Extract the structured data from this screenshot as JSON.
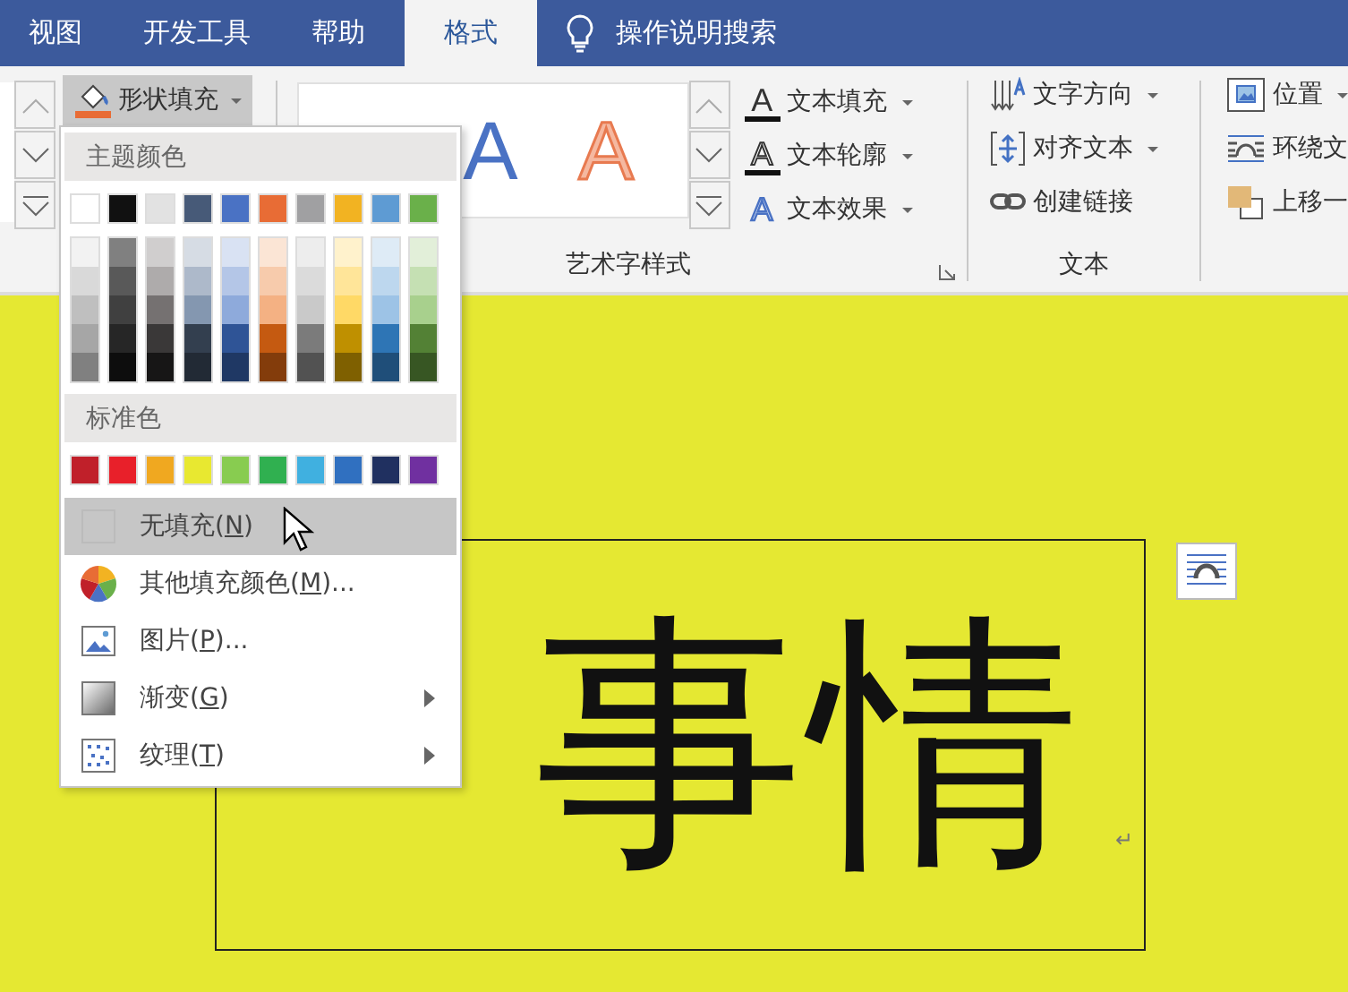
{
  "tabs": [
    {
      "label": "视图",
      "selected": false
    },
    {
      "label": "开发工具",
      "selected": false
    },
    {
      "label": "帮助",
      "selected": false
    },
    {
      "label": "格式",
      "selected": true
    }
  ],
  "search": {
    "placeholder": "操作说明搜索"
  },
  "ribbon": {
    "shape_fill": {
      "label": "形状填充",
      "pressed": true
    },
    "wordart": {
      "label": "艺术字样式",
      "styles": [
        {
          "kind": "fill",
          "letter": "A"
        },
        {
          "kind": "outline",
          "letter": "A"
        }
      ],
      "commands": [
        {
          "kind": "fill",
          "glyph": "A",
          "label": "文本填充",
          "dropdown": true
        },
        {
          "kind": "outline",
          "glyph": "A",
          "label": "文本轮廓",
          "dropdown": true
        },
        {
          "kind": "effect",
          "glyph": "A",
          "label": "文本效果",
          "dropdown": true
        }
      ]
    },
    "text": {
      "label": "文本",
      "commands": [
        {
          "kind": "direction",
          "label": "文字方向",
          "dropdown": true
        },
        {
          "kind": "align",
          "label": "对齐文本",
          "dropdown": true
        },
        {
          "kind": "link",
          "label": "创建链接",
          "dropdown": false
        }
      ]
    },
    "arrange": {
      "commands": [
        {
          "kind": "position",
          "label": "位置",
          "dropdown": true
        },
        {
          "kind": "wrap",
          "label": "环绕文",
          "dropdown": false
        },
        {
          "kind": "forward",
          "label": "上移一",
          "dropdown": false
        }
      ]
    }
  },
  "fill_menu": {
    "theme_header": "主题颜色",
    "theme_colors": [
      {
        "color": "#ffffff",
        "shades": [
          {
            "color": "#f2f2f2"
          },
          {
            "color": "#d9d9d9"
          },
          {
            "color": "#bfbfbf"
          },
          {
            "color": "#a6a6a6"
          },
          {
            "color": "#808080"
          }
        ]
      },
      {
        "color": "#111111",
        "shades": [
          {
            "color": "#808080"
          },
          {
            "color": "#595959"
          },
          {
            "color": "#404040"
          },
          {
            "color": "#262626"
          },
          {
            "color": "#0d0d0d"
          }
        ]
      },
      {
        "color": "#e2e2e2",
        "shades": [
          {
            "color": "#d0cece"
          },
          {
            "color": "#aeabab"
          },
          {
            "color": "#757171"
          },
          {
            "color": "#3a3838"
          },
          {
            "color": "#171616"
          }
        ]
      },
      {
        "color": "#475a78",
        "shades": [
          {
            "color": "#d6dce4"
          },
          {
            "color": "#adb9ca"
          },
          {
            "color": "#8497b0"
          },
          {
            "color": "#333f4f"
          },
          {
            "color": "#222a35"
          }
        ]
      },
      {
        "color": "#4a72c4",
        "shades": [
          {
            "color": "#d9e2f3"
          },
          {
            "color": "#b4c6e7"
          },
          {
            "color": "#8eaadb"
          },
          {
            "color": "#2f5496"
          },
          {
            "color": "#1f3864"
          }
        ]
      },
      {
        "color": "#e86c35",
        "shades": [
          {
            "color": "#fbe5d5"
          },
          {
            "color": "#f7cbac"
          },
          {
            "color": "#f4b183"
          },
          {
            "color": "#c55a11"
          },
          {
            "color": "#833c0b"
          }
        ]
      },
      {
        "color": "#a0a0a2",
        "shades": [
          {
            "color": "#ededed"
          },
          {
            "color": "#dbdbdb"
          },
          {
            "color": "#c9c9c9"
          },
          {
            "color": "#7b7b7b"
          },
          {
            "color": "#525252"
          }
        ]
      },
      {
        "color": "#f2b322",
        "shades": [
          {
            "color": "#fff2cc"
          },
          {
            "color": "#ffe599"
          },
          {
            "color": "#ffd966"
          },
          {
            "color": "#bf9000"
          },
          {
            "color": "#7f6000"
          }
        ]
      },
      {
        "color": "#5e9bd3",
        "shades": [
          {
            "color": "#deebf6"
          },
          {
            "color": "#bdd7ee"
          },
          {
            "color": "#9dc3e6"
          },
          {
            "color": "#2e75b5"
          },
          {
            "color": "#1f4e79"
          }
        ]
      },
      {
        "color": "#6ab04a",
        "shades": [
          {
            "color": "#e2efd9"
          },
          {
            "color": "#c5e0b3"
          },
          {
            "color": "#a8d08d"
          },
          {
            "color": "#538135"
          },
          {
            "color": "#375623"
          }
        ]
      }
    ],
    "standard_header": "标准色",
    "standard_colors": [
      {
        "color": "#c0202a"
      },
      {
        "color": "#e8202a"
      },
      {
        "color": "#f0a820"
      },
      {
        "color": "#e8e830"
      },
      {
        "color": "#88cc50"
      },
      {
        "color": "#30b050"
      },
      {
        "color": "#40b0e0"
      },
      {
        "color": "#3070c0"
      },
      {
        "color": "#203060"
      },
      {
        "color": "#7030a0"
      }
    ],
    "items": [
      {
        "kind": "none",
        "before": "无填充(",
        "key": "N",
        "after": ")",
        "selected": true,
        "submenu": false
      },
      {
        "kind": "more",
        "before": "其他填充颜色(",
        "key": "M",
        "after": ")...",
        "selected": false,
        "submenu": false
      },
      {
        "kind": "picture",
        "before": "图片(",
        "key": "P",
        "after": ")...",
        "selected": false,
        "submenu": false
      },
      {
        "kind": "gradient",
        "before": "渐变(",
        "key": "G",
        "after": ")",
        "selected": false,
        "submenu": true
      },
      {
        "kind": "texture",
        "before": "纹理(",
        "key": "T",
        "after": ")",
        "selected": false,
        "submenu": true
      }
    ]
  },
  "document": {
    "text": "事情",
    "mark": "↵"
  }
}
